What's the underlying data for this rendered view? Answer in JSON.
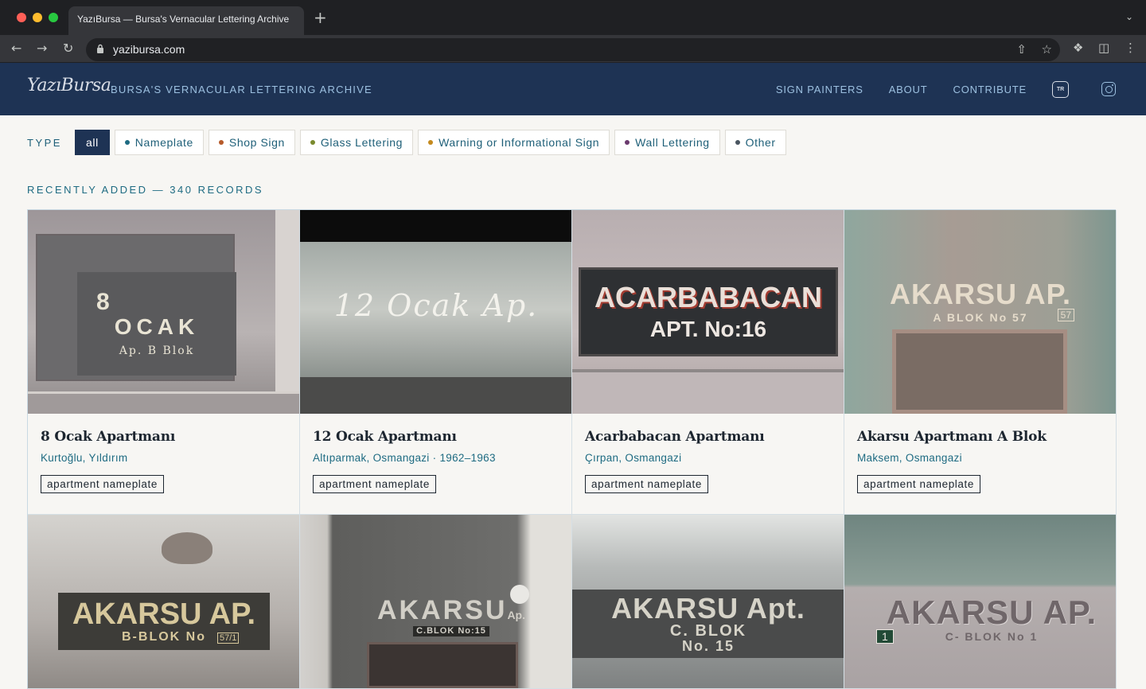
{
  "browser": {
    "tab_title": "YazıBursa — Bursa's Vernacular Lettering Archive",
    "new_tab": "+",
    "url": "yazibursa.com"
  },
  "site": {
    "logo": "YazıBursa",
    "tagline": "BURSA'S VERNACULAR LETTERING ARCHIVE",
    "nav": {
      "sign_painters": "SIGN PAINTERS",
      "about": "ABOUT",
      "contribute": "CONTRIBUTE",
      "language": "TR"
    }
  },
  "filters": {
    "label": "TYPE",
    "items": [
      {
        "label": "all",
        "active": true,
        "color": ""
      },
      {
        "label": "Nameplate",
        "active": false,
        "color": "#1e6b82"
      },
      {
        "label": "Shop Sign",
        "active": false,
        "color": "#b55a2a"
      },
      {
        "label": "Glass Lettering",
        "active": false,
        "color": "#7a8a2e"
      },
      {
        "label": "Warning or Informational Sign",
        "active": false,
        "color": "#c48a1e"
      },
      {
        "label": "Wall Lettering",
        "active": false,
        "color": "#6b3a6e"
      },
      {
        "label": "Other",
        "active": false,
        "color": "#4a5560"
      }
    ]
  },
  "recent": {
    "heading": "RECENTLY ADDED — 340 RECORDS"
  },
  "cards": [
    {
      "title": "8 Ocak Apartmanı",
      "location": "Kurtoğlu, Yıldırım",
      "tag": "apartment nameplate",
      "sign": {
        "line1": "8",
        "line2": "OCAK",
        "line3": "Ap.   B Blok"
      }
    },
    {
      "title": "12 Ocak Apartmanı",
      "location": "Altıparmak, Osmangazi  ·  1962–1963",
      "tag": "apartment nameplate",
      "sign": {
        "line1": "12 Ocak Ap."
      }
    },
    {
      "title": "Acarbabacan Apartmanı",
      "location": "Çırpan, Osmangazi",
      "tag": "apartment nameplate",
      "sign": {
        "line1": "ACARBABACAN",
        "line2": "APT. No:16"
      }
    },
    {
      "title": "Akarsu Apartmanı A Blok",
      "location": "Maksem, Osmangazi",
      "tag": "apartment nameplate",
      "sign": {
        "line1": "AKARSU AP.",
        "line2": "A BLOK  No 57",
        "num": "57"
      }
    },
    {
      "sign": {
        "line1": "AKARSU AP.",
        "line2": "B-BLOK  No",
        "num": "57/1"
      }
    },
    {
      "sign": {
        "line1": "AKARSU",
        "line1b": "Ap.",
        "line2": "C.BLOK  No:15"
      }
    },
    {
      "sign": {
        "line1": "AKARSU Apt.",
        "line2": "C. BLOK",
        "line3": "No. 15"
      }
    },
    {
      "sign": {
        "line1": "AKARSU AP.",
        "line2": "C- BLOK  No 1",
        "num": "1"
      }
    }
  ]
}
